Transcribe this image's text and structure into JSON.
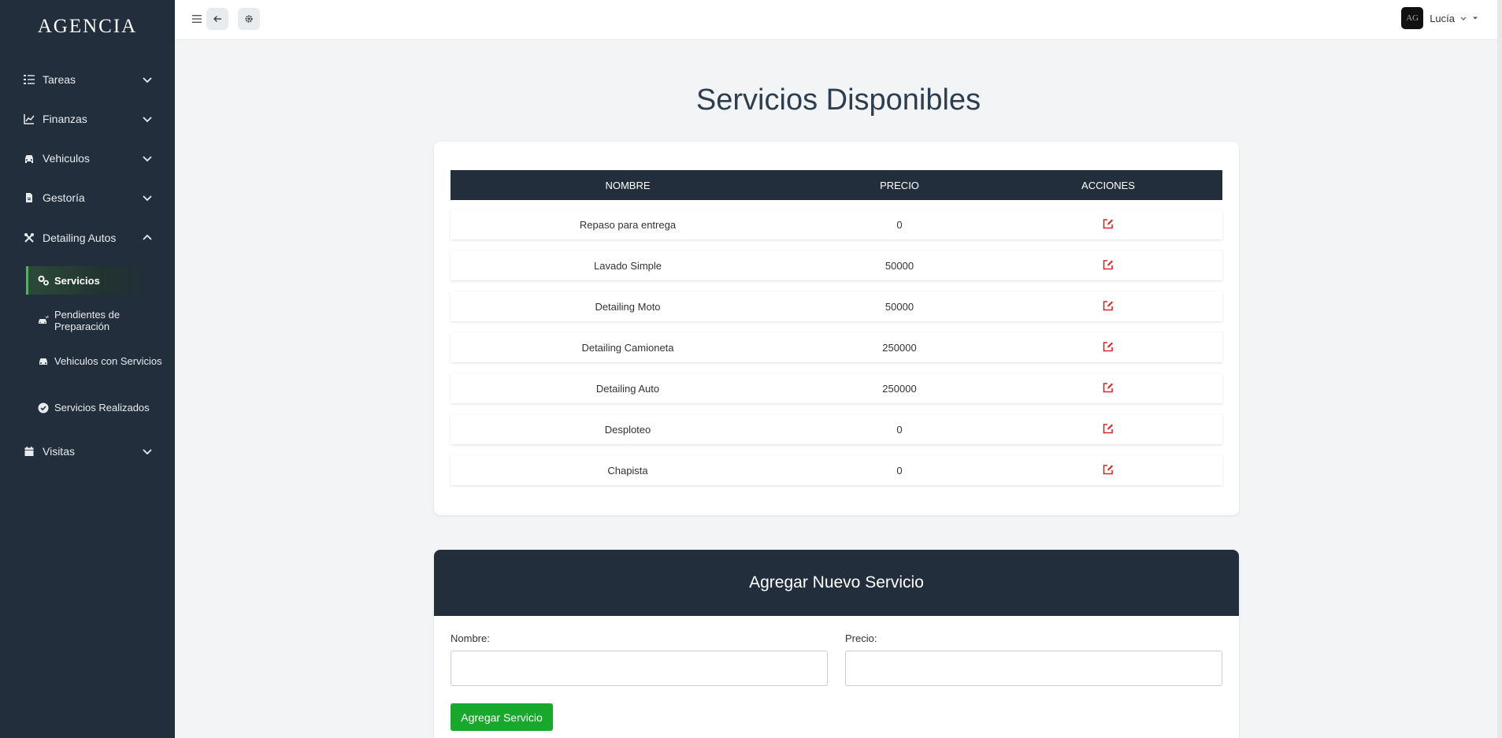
{
  "brand": "AGENCIA",
  "sidebar": {
    "items": [
      {
        "label": "Tareas",
        "icon": "tasks-icon"
      },
      {
        "label": "Finanzas",
        "icon": "chart-line-icon"
      },
      {
        "label": "Vehiculos",
        "icon": "car-icon"
      },
      {
        "label": "Gestoría",
        "icon": "file-icon"
      },
      {
        "label": "Detailing Autos",
        "icon": "tools-icon"
      },
      {
        "label": "Visitas",
        "icon": "calendar-icon"
      }
    ],
    "subitems": [
      {
        "label": "Servicios",
        "icon": "gears-icon",
        "active": true
      },
      {
        "label": "Pendientes de Preparación",
        "icon": "car-wash-icon"
      },
      {
        "label": "Vehiculos con Servicios",
        "icon": "car-icon"
      },
      {
        "label": "Servicios Realizados",
        "icon": "check-circle-icon"
      }
    ]
  },
  "topbar": {
    "user_name": "Lucía",
    "avatar_text": "AG"
  },
  "main": {
    "title": "Servicios Disponibles",
    "table": {
      "headers": [
        "NOMBRE",
        "PRECIO",
        "ACCIONES"
      ],
      "rows": [
        {
          "nombre": "Repaso para entrega",
          "precio": "0"
        },
        {
          "nombre": "Lavado Simple",
          "precio": "50000"
        },
        {
          "nombre": "Detailing Moto",
          "precio": "50000"
        },
        {
          "nombre": "Detailing Camioneta",
          "precio": "250000"
        },
        {
          "nombre": "Detailing Auto",
          "precio": "250000"
        },
        {
          "nombre": "Desploteo",
          "precio": "0"
        },
        {
          "nombre": "Chapista",
          "precio": "0"
        }
      ]
    },
    "form": {
      "title": "Agregar Nuevo Servicio",
      "nombre_label": "Nombre:",
      "nombre_value": "",
      "precio_label": "Precio:",
      "precio_value": "",
      "submit_label": "Agregar Servicio"
    }
  },
  "colors": {
    "sidebar_bg": "#222e3c",
    "accent_green": "#17a82c",
    "edit_red": "#e02424",
    "title_color": "#2c3e50"
  }
}
